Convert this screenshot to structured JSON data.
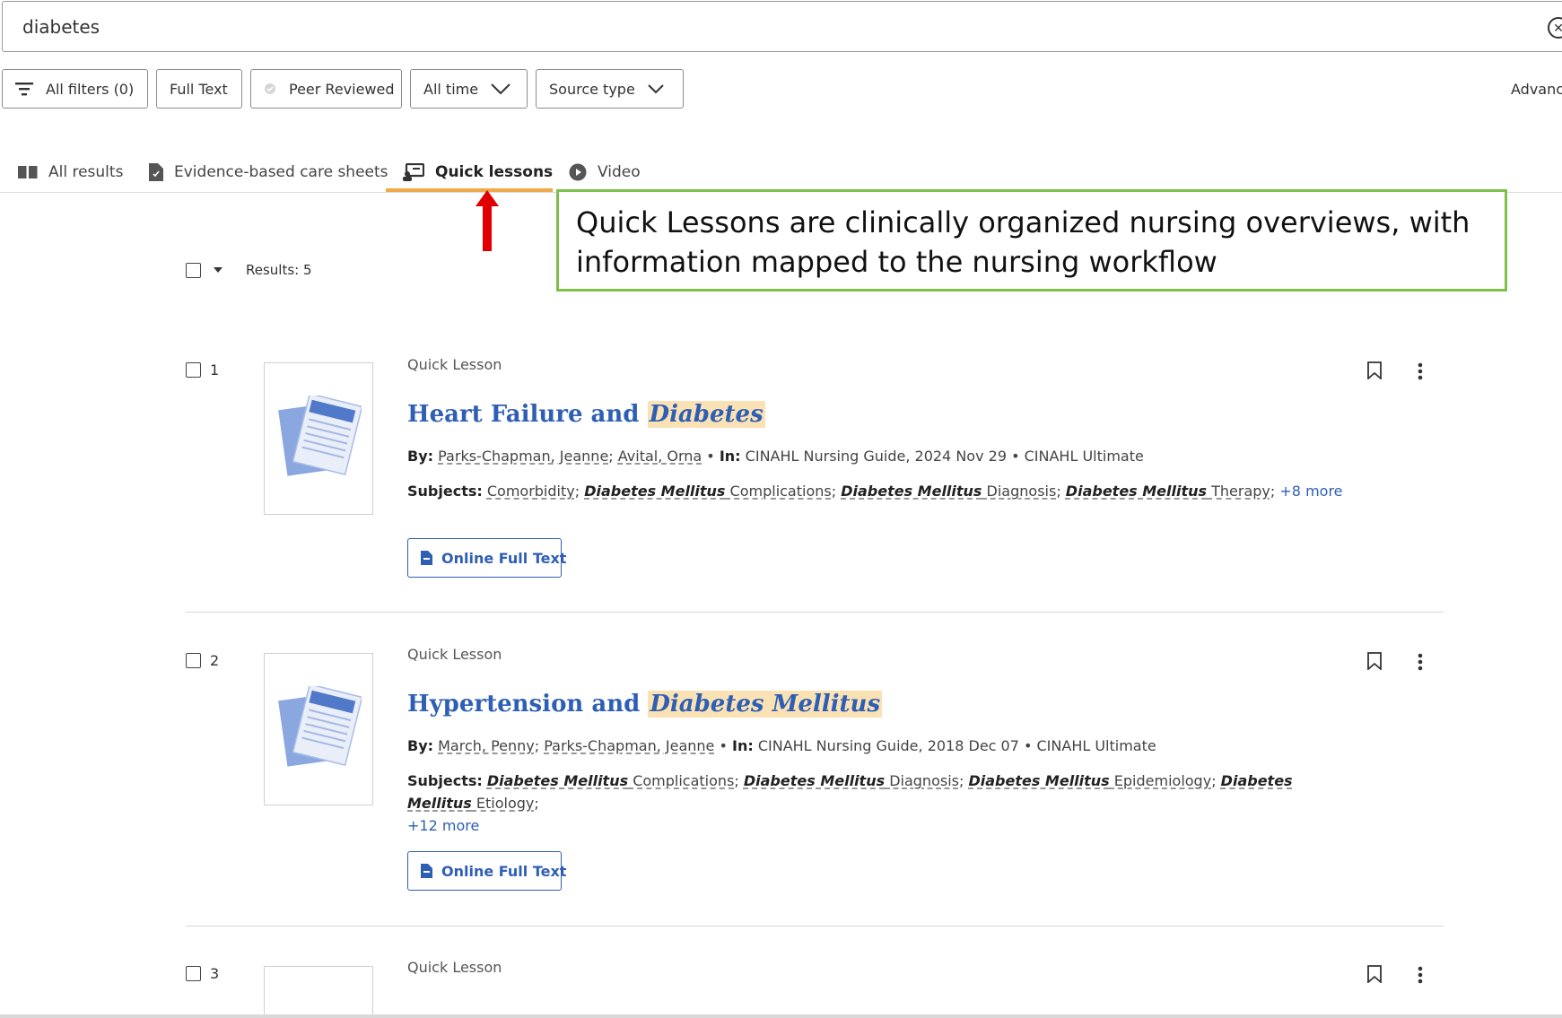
{
  "search": {
    "value": "diabetes",
    "clear_icon": "close-circle-icon"
  },
  "filters": {
    "all_filters": "All filters (0)",
    "full_text": "Full Text",
    "peer_reviewed": "Peer Reviewed",
    "time": "All time",
    "source_type": "Source type",
    "advanced": "Advanc"
  },
  "tabs": [
    {
      "label": "All results",
      "icon": "book-icon",
      "active": false
    },
    {
      "label": "Evidence-based care sheets",
      "icon": "document-icon",
      "active": false
    },
    {
      "label": "Quick lessons",
      "icon": "lesson-icon",
      "active": true
    },
    {
      "label": "Video",
      "icon": "play-icon",
      "active": false
    }
  ],
  "callout": {
    "text": "Quick Lessons are clinically organized nursing overviews, with information mapped to the nursing workflow",
    "border_color": "#7cc04b",
    "arrow_color": "#e00000"
  },
  "results_bar": {
    "count_label": "Results: 5"
  },
  "results": [
    {
      "number": "1",
      "type": "Quick Lesson",
      "title_plain": "Heart Failure and ",
      "title_highlight": "Diabetes",
      "by_label": "By:",
      "authors": [
        "Parks-Chapman, Jeanne",
        "Avital, Orna"
      ],
      "in_label": "In:",
      "source": "CINAHL Nursing Guide, 2024 Nov 29 • CINAHL Ultimate",
      "subjects_label": "Subjects:",
      "subjects": [
        {
          "em": "",
          "rest": "Comorbidity"
        },
        {
          "em": "Diabetes Mellitus",
          "rest": " Complications"
        },
        {
          "em": "Diabetes Mellitus",
          "rest": " Diagnosis"
        },
        {
          "em": "Diabetes Mellitus",
          "rest": " Therapy"
        }
      ],
      "more": "+8 more",
      "button": "Online Full Text"
    },
    {
      "number": "2",
      "type": "Quick Lesson",
      "title_plain": "Hypertension and ",
      "title_highlight": "Diabetes Mellitus",
      "by_label": "By:",
      "authors": [
        "March, Penny",
        "Parks-Chapman, Jeanne"
      ],
      "in_label": "In:",
      "source": "CINAHL Nursing Guide, 2018 Dec 07 • CINAHL Ultimate",
      "subjects_label": "Subjects:",
      "subjects": [
        {
          "em": "Diabetes Mellitus",
          "rest": " Complications"
        },
        {
          "em": "Diabetes Mellitus",
          "rest": " Diagnosis"
        },
        {
          "em": "Diabetes Mellitus",
          "rest": " Epidemiology"
        },
        {
          "em": "Diabetes Mellitus",
          "rest": " Etiology"
        }
      ],
      "more": "+12 more",
      "button": "Online Full Text"
    },
    {
      "number": "3",
      "type": "Quick Lesson"
    }
  ],
  "colors": {
    "link": "#2f5fb4",
    "highlight": "#fbe2b5",
    "tab_underline": "#f0a94a"
  }
}
